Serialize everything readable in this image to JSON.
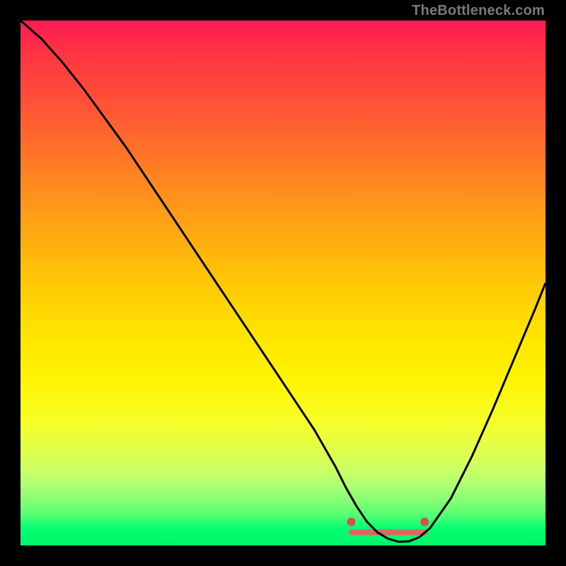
{
  "watermark": "TheBottleneck.com",
  "chart_data": {
    "type": "line",
    "title": "",
    "xlabel": "",
    "ylabel": "",
    "xlim": [
      0,
      100
    ],
    "ylim": [
      0,
      100
    ],
    "series": [
      {
        "name": "curve",
        "x": [
          0,
          4,
          8,
          12,
          16,
          20,
          24,
          28,
          32,
          36,
          40,
          44,
          48,
          52,
          56,
          60,
          62,
          64,
          66,
          68,
          70,
          72,
          74,
          76,
          78,
          82,
          86,
          90,
          94,
          98,
          100
        ],
        "y": [
          100,
          96.5,
          92,
          87,
          81.5,
          76,
          70,
          64,
          58,
          52,
          46,
          40,
          34,
          28,
          22,
          15,
          11,
          7.5,
          4.5,
          2.5,
          1.3,
          0.7,
          0.8,
          1.6,
          3.3,
          9,
          17,
          26,
          35.5,
          45,
          50
        ]
      }
    ],
    "flat_region": {
      "x_start": 63,
      "x_end": 77,
      "y": 2.5
    },
    "markers": [
      {
        "x": 63,
        "y": 4.5
      },
      {
        "x": 77,
        "y": 4.5
      }
    ],
    "colors": {
      "curve": "#000000",
      "flat_band": "#e06666",
      "marker": "#d94f4f",
      "gradient_top": "#ff1a53",
      "gradient_bottom": "#00f56a"
    }
  }
}
